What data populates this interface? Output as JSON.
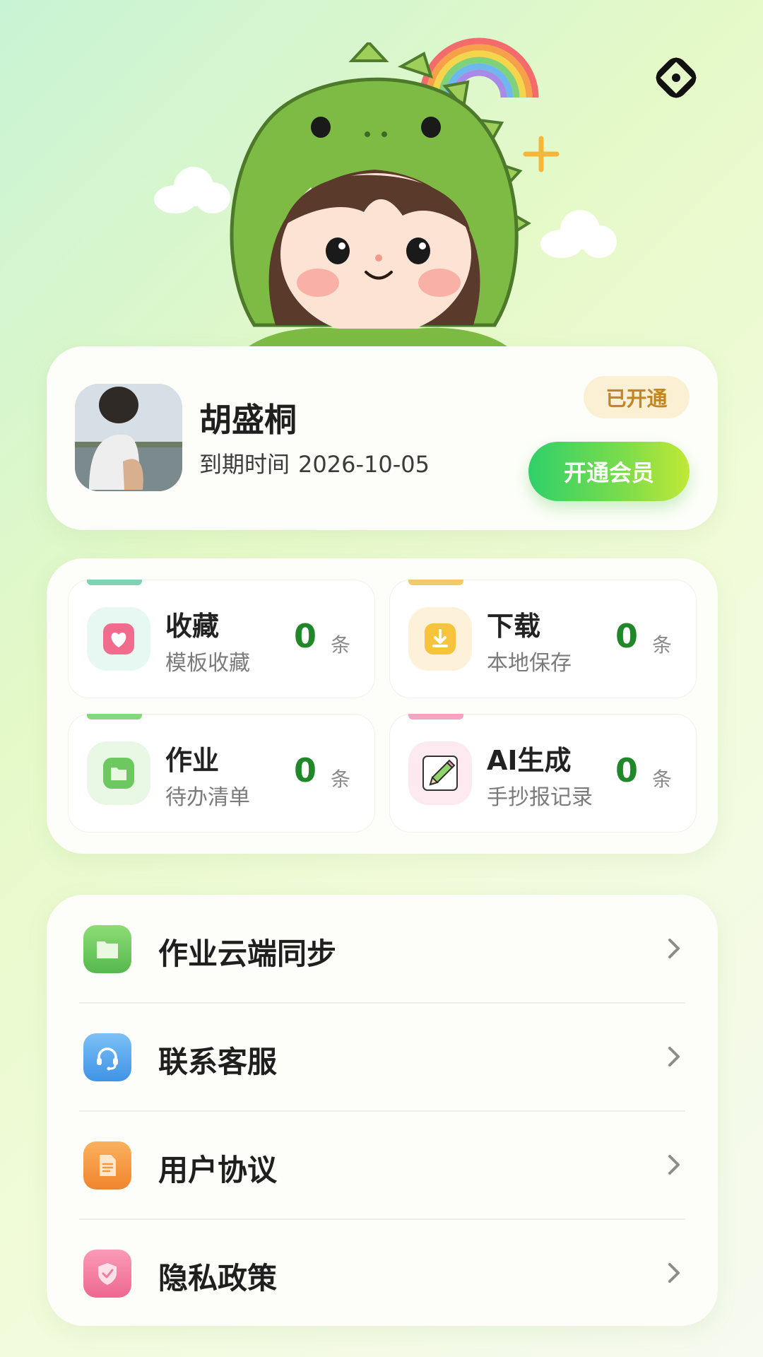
{
  "profile": {
    "name": "胡盛桐",
    "expire_label": "到期时间",
    "expire_date": "2026-10-05",
    "status_badge": "已开通",
    "vip_button": "开通会员"
  },
  "stats": [
    {
      "title": "收藏",
      "subtitle": "模板收藏",
      "count": "0",
      "unit": "条",
      "icon": "heart-icon",
      "color": "#ef6d8c"
    },
    {
      "title": "下载",
      "subtitle": "本地保存",
      "count": "0",
      "unit": "条",
      "icon": "download-icon",
      "color": "#f3c23a"
    },
    {
      "title": "作业",
      "subtitle": "待办清单",
      "count": "0",
      "unit": "条",
      "icon": "folder-icon",
      "color": "#6cc85f"
    },
    {
      "title": "AI生成",
      "subtitle": "手抄报记录",
      "count": "0",
      "unit": "条",
      "icon": "pencil-icon",
      "color": "#f2a4c0"
    }
  ],
  "menu": [
    {
      "label": "作业云端同步",
      "icon": "folder-icon",
      "color": "#6cc85f"
    },
    {
      "label": "联系客服",
      "icon": "headset-icon",
      "color": "#4aa3ee"
    },
    {
      "label": "用户协议",
      "icon": "document-icon",
      "color": "#f39a3d"
    },
    {
      "label": "隐私政策",
      "icon": "shield-icon",
      "color": "#f27ca0"
    }
  ]
}
